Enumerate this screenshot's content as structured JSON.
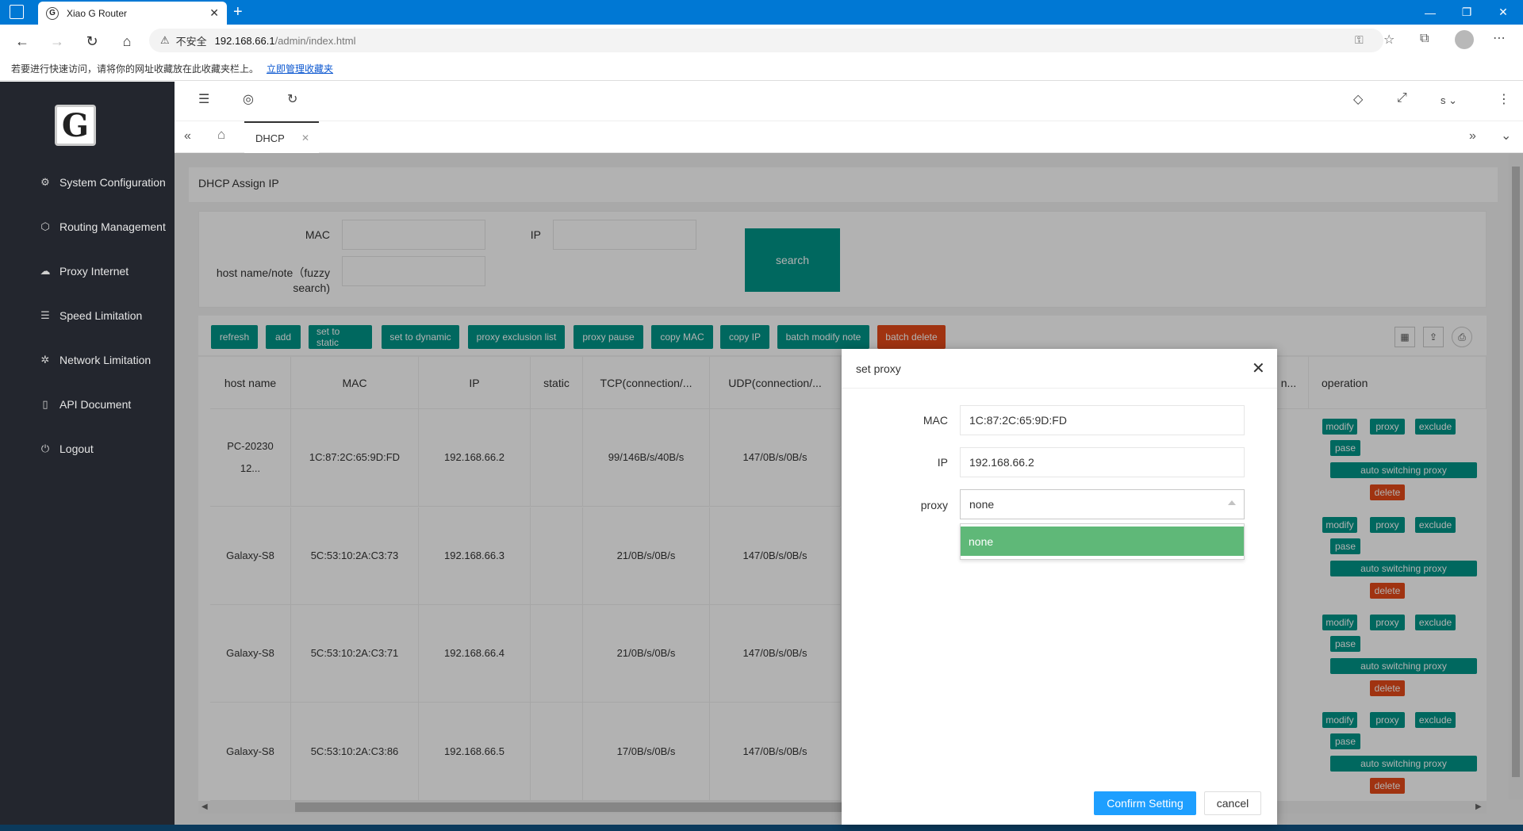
{
  "browser": {
    "tab_title": "Xiao G Router",
    "tab_favicon": "G",
    "url_warning": "不安全",
    "url_host": "192.168.66.1",
    "url_path": "/admin/index.html",
    "bookmark_hint": "若要进行快速访问，请将你的网址收藏放在此收藏夹栏上。",
    "bookmark_link": "立即管理收藏夹"
  },
  "sidebar": {
    "logo": "G",
    "items": [
      {
        "label": "System Configuration",
        "icon": "gear-icon",
        "glyph": "⚙"
      },
      {
        "label": "Routing Management",
        "icon": "cube-icon",
        "glyph": "⬡"
      },
      {
        "label": "Proxy Internet",
        "icon": "cloud-icon",
        "glyph": "☁"
      },
      {
        "label": "Speed Limitation",
        "icon": "sliders-icon",
        "glyph": "☰"
      },
      {
        "label": "Network Limitation",
        "icon": "network-icon",
        "glyph": "✲"
      },
      {
        "label": "API Document",
        "icon": "document-icon",
        "glyph": "▯"
      },
      {
        "label": "Logout",
        "icon": "power-icon",
        "glyph": "⏻"
      }
    ]
  },
  "topbar": {
    "user_initial": "s"
  },
  "tabs": {
    "active_label": "DHCP"
  },
  "page": {
    "card_title": "DHCP Assign IP",
    "search": {
      "mac_label": "MAC",
      "ip_label": "IP",
      "host_label_line1": "host name/note（fuzzy",
      "host_label_line2": "search)",
      "button": "search"
    },
    "toolbar": [
      "refresh",
      "add",
      "set to static",
      "set to dynamic",
      "proxy exclusion list",
      "proxy pause",
      "copy MAC",
      "copy IP",
      "batch modify note",
      "batch delete"
    ],
    "table": {
      "headers": [
        "host name",
        "MAC",
        "IP",
        "static",
        "TCP(connection/...",
        "UDP(connection/...",
        "n...",
        "operation"
      ],
      "rows": [
        {
          "host": "PC-2023012...",
          "mac": "1C:87:2C:65:9D:FD",
          "ip": "192.168.66.2",
          "static": "",
          "tcp": "99/146B/s/40B/s",
          "udp": "147/0B/s/0B/s"
        },
        {
          "host": "Galaxy-S8",
          "mac": "5C:53:10:2A:C3:73",
          "ip": "192.168.66.3",
          "static": "",
          "tcp": "21/0B/s/0B/s",
          "udp": "147/0B/s/0B/s"
        },
        {
          "host": "Galaxy-S8",
          "mac": "5C:53:10:2A:C3:71",
          "ip": "192.168.66.4",
          "static": "",
          "tcp": "21/0B/s/0B/s",
          "udp": "147/0B/s/0B/s"
        },
        {
          "host": "Galaxy-S8",
          "mac": "5C:53:10:2A:C3:86",
          "ip": "192.168.66.5",
          "static": "",
          "tcp": "17/0B/s/0B/s",
          "udp": "147/0B/s/0B/s"
        }
      ],
      "op_buttons": {
        "modify": "modify",
        "proxy": "proxy",
        "exclude": "exclude",
        "pase": "pase",
        "auto": "auto switching proxy",
        "delete": "delete"
      }
    }
  },
  "modal": {
    "title": "set proxy",
    "mac_label": "MAC",
    "mac_value": "1C:87:2C:65:9D:FD",
    "ip_label": "IP",
    "ip_value": "192.168.66.2",
    "proxy_label": "proxy",
    "proxy_value": "none",
    "dropdown_options": [
      "none"
    ],
    "confirm": "Confirm Setting",
    "cancel": "cancel"
  },
  "colors": {
    "primary": "#009688",
    "danger": "#e64a19",
    "selected_option": "#5fb878",
    "confirm": "#1e9fff",
    "sidebar": "#23262e",
    "titlebar": "#0078d4"
  }
}
